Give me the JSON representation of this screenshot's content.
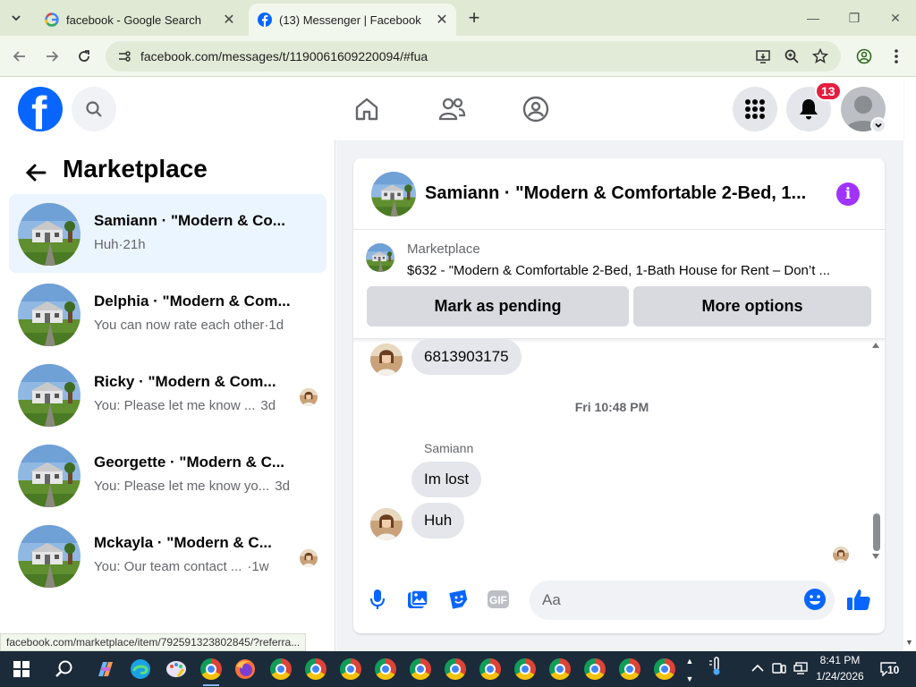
{
  "browser": {
    "tabs": [
      {
        "title": "facebook - Google Search",
        "icon": "google-icon"
      },
      {
        "title": "(13) Messenger | Facebook",
        "icon": "facebook-icon",
        "active": true
      }
    ],
    "url": "facebook.com/messages/t/1190061609220094/#fua",
    "status_url": "facebook.com/marketplace/item/792591323802845/?referra..."
  },
  "header": {
    "notification_count": "13"
  },
  "left_panel": {
    "title": "Marketplace",
    "conversations": [
      {
        "name": "Samiann · \"Modern & Co...",
        "snippet": "Huh",
        "time": "·21h",
        "selected": true
      },
      {
        "name": "Delphia · \"Modern & Com...",
        "snippet": "You can now rate each other",
        "time": "·1d"
      },
      {
        "name": "Ricky · \"Modern & Com...",
        "snippet": "You: Please let me know ...",
        "time": "3d"
      },
      {
        "name": "Georgette · \"Modern & C...",
        "snippet": "You: Please let me know yo...",
        "time": "3d"
      },
      {
        "name": "Mckayla · \"Modern & C...",
        "snippet": "You: Our team contact ...",
        "time": "·1w"
      }
    ]
  },
  "chat": {
    "header_title": "Samiann · \"Modern & Comfortable 2-Bed, 1...",
    "listing_label": "Marketplace",
    "listing_title": "$632 - \"Modern & Comfortable 2-Bed, 1-Bath House for Rent – Don’t ...",
    "mark_pending_label": "Mark as pending",
    "more_options_label": "More options",
    "messages": {
      "phone": "6813903175",
      "timestamp": "Fri 10:48 PM",
      "sender": "Samiann",
      "msg1": "Im lost",
      "msg2": "Huh"
    },
    "composer_placeholder": "Aa"
  },
  "taskbar": {
    "time": "8:41 PM",
    "date": "1/24/2026",
    "notifications": "10"
  },
  "colors": {
    "fb_blue": "#0866ff",
    "selected_bg": "#ebf5ff",
    "badge_red": "#e41e3f",
    "info_purple": "#a033ff"
  }
}
